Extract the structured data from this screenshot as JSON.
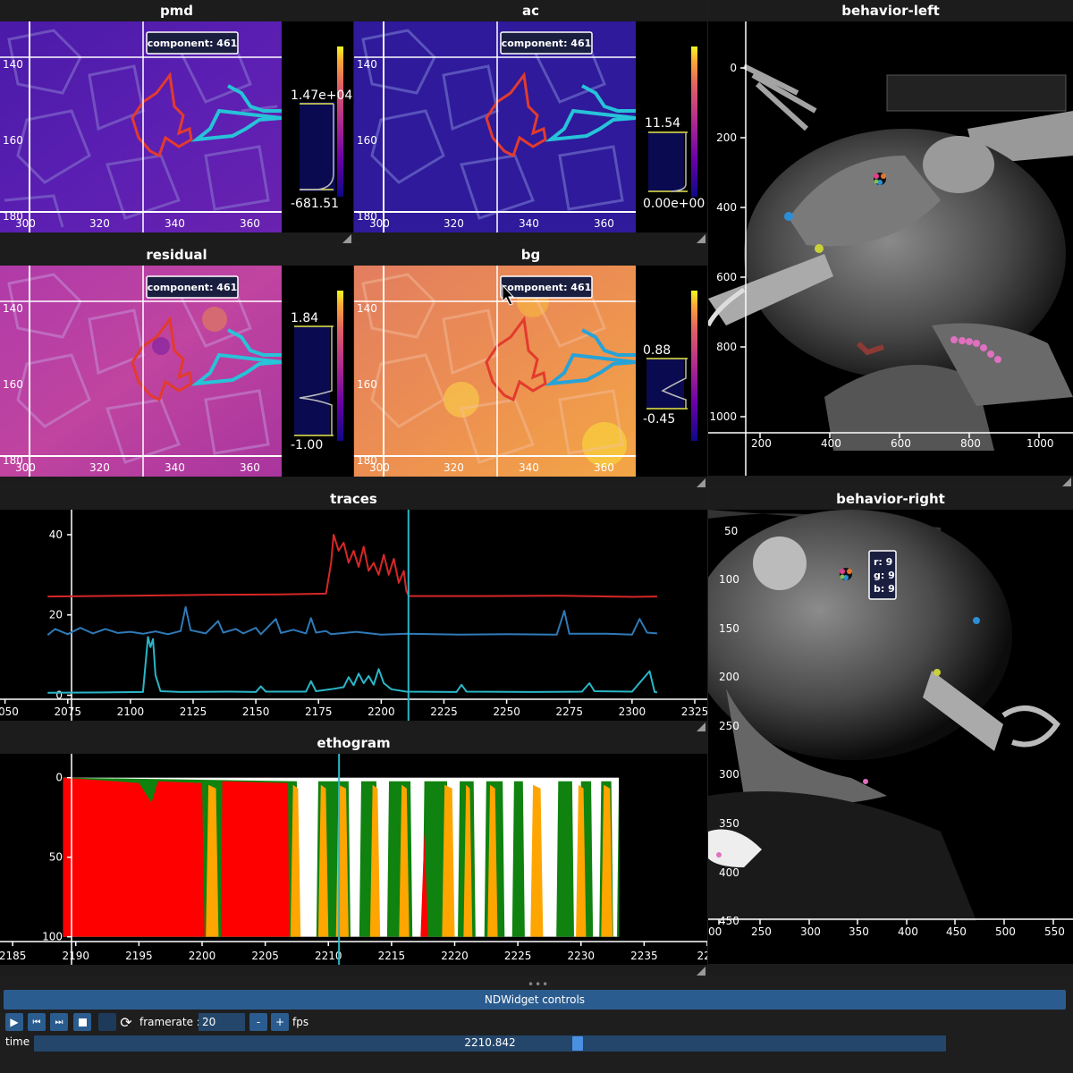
{
  "panels": {
    "pmd": {
      "title": "pmd",
      "tooltip": "component: 461",
      "cmax": "1.47e+04",
      "cmin": "-681.51"
    },
    "ac": {
      "title": "ac",
      "tooltip": "component: 461",
      "cmax": "11.54",
      "cmin": "0.00e+00"
    },
    "residual": {
      "title": "residual",
      "tooltip": "component: 461",
      "cmax": "1.84",
      "cmin": "-1.00"
    },
    "bg": {
      "title": "bg",
      "tooltip": "component: 461",
      "cmax": "0.88",
      "cmin": "-0.45"
    },
    "behavior_left": {
      "title": "behavior-left"
    },
    "behavior_right": {
      "title": "behavior-right",
      "pixel_info": {
        "r": "r: 9",
        "g": "g: 9",
        "b": "b: 9"
      }
    },
    "traces": {
      "title": "traces"
    },
    "ethogram": {
      "title": "ethogram"
    }
  },
  "image_axes": {
    "x_ticks": [
      "300",
      "320",
      "340",
      "360"
    ],
    "y_ticks": [
      "140",
      "160",
      "180"
    ]
  },
  "behavior_left_axes": {
    "x_ticks": [
      "200",
      "400",
      "600",
      "800",
      "1000"
    ],
    "y_ticks": [
      "0",
      "200",
      "400",
      "600",
      "800",
      "1000"
    ]
  },
  "behavior_right_axes": {
    "x_ticks": [
      "00",
      "250",
      "300",
      "350",
      "400",
      "450",
      "500",
      "550"
    ],
    "y_ticks": [
      "50",
      "100",
      "150",
      "200",
      "250",
      "300",
      "350",
      "400",
      "450"
    ]
  },
  "chart_data": [
    {
      "type": "line",
      "title": "traces",
      "xlim": [
        2048,
        2330
      ],
      "ylim": [
        -1,
        44
      ],
      "x_ticks": [
        "2050",
        "2075",
        "2100",
        "2125",
        "2150",
        "2175",
        "2200",
        "2225",
        "2250",
        "2275",
        "2300",
        "2325",
        "23"
      ],
      "y_ticks": [
        "40",
        "20",
        "0"
      ],
      "cursor_x": 2210.842,
      "colors": [
        "#d62728",
        "#2f7ab8",
        "#2ab6c7"
      ],
      "series": [
        {
          "values": [
            [
              2067,
              24.6
            ],
            [
              2100,
              24.8
            ],
            [
              2130,
              25.0
            ],
            [
              2160,
              25.1
            ],
            [
              2178,
              25.3
            ],
            [
              2180,
              33
            ],
            [
              2181,
              40
            ],
            [
              2183,
              36
            ],
            [
              2185,
              38
            ],
            [
              2187,
              33
            ],
            [
              2189,
              36
            ],
            [
              2191,
              32
            ],
            [
              2193,
              37
            ],
            [
              2195,
              31
            ],
            [
              2197,
              33
            ],
            [
              2199,
              30
            ],
            [
              2201,
              35
            ],
            [
              2203,
              30
            ],
            [
              2205,
              34
            ],
            [
              2207,
              28
            ],
            [
              2209,
              31
            ],
            [
              2210,
              26
            ],
            [
              2211,
              24.7
            ],
            [
              2240,
              24.7
            ],
            [
              2270,
              24.8
            ],
            [
              2300,
              24.5
            ],
            [
              2310,
              24.6
            ]
          ]
        },
        {
          "values": [
            [
              2067,
              15
            ],
            [
              2070,
              16.5
            ],
            [
              2075,
              15.2
            ],
            [
              2080,
              16.8
            ],
            [
              2085,
              15.4
            ],
            [
              2090,
              16.5
            ],
            [
              2095,
              15.5
            ],
            [
              2100,
              15.8
            ],
            [
              2105,
              15.3
            ],
            [
              2110,
              15.9
            ],
            [
              2115,
              15.2
            ],
            [
              2120,
              16
            ],
            [
              2122,
              22
            ],
            [
              2124,
              16.2
            ],
            [
              2130,
              15.4
            ],
            [
              2135,
              18.5
            ],
            [
              2137,
              15.6
            ],
            [
              2142,
              16.5
            ],
            [
              2145,
              15.4
            ],
            [
              2150,
              16.8
            ],
            [
              2152,
              15.2
            ],
            [
              2158,
              19
            ],
            [
              2160,
              15.5
            ],
            [
              2165,
              16.3
            ],
            [
              2170,
              15.4
            ],
            [
              2172,
              19.2
            ],
            [
              2174,
              15.6
            ],
            [
              2178,
              16
            ],
            [
              2180,
              15.2
            ],
            [
              2190,
              15.8
            ],
            [
              2200,
              15.1
            ],
            [
              2210,
              15.3
            ],
            [
              2230,
              15.1
            ],
            [
              2250,
              15.2
            ],
            [
              2270,
              15.1
            ],
            [
              2273,
              21
            ],
            [
              2275,
              15.3
            ],
            [
              2290,
              15.3
            ],
            [
              2300,
              15.1
            ],
            [
              2303,
              19
            ],
            [
              2306,
              15.6
            ],
            [
              2310,
              15.4
            ]
          ]
        },
        {
          "values": [
            [
              2067,
              0.6
            ],
            [
              2090,
              0.7
            ],
            [
              2105,
              0.8
            ],
            [
              2107,
              14.5
            ],
            [
              2108,
              12
            ],
            [
              2109,
              14
            ],
            [
              2110,
              5
            ],
            [
              2112,
              1
            ],
            [
              2120,
              0.8
            ],
            [
              2140,
              0.9
            ],
            [
              2150,
              0.8
            ],
            [
              2152,
              2.2
            ],
            [
              2154,
              0.9
            ],
            [
              2170,
              0.9
            ],
            [
              2172,
              3.5
            ],
            [
              2174,
              1
            ],
            [
              2180,
              1.5
            ],
            [
              2185,
              2
            ],
            [
              2187,
              4.5
            ],
            [
              2189,
              2.5
            ],
            [
              2191,
              5.4
            ],
            [
              2193,
              3
            ],
            [
              2195,
              4.8
            ],
            [
              2197,
              2.6
            ],
            [
              2199,
              6.5
            ],
            [
              2201,
              3
            ],
            [
              2204,
              1.5
            ],
            [
              2210,
              0.9
            ],
            [
              2230,
              0.8
            ],
            [
              2232,
              2.6
            ],
            [
              2234,
              0.9
            ],
            [
              2260,
              0.8
            ],
            [
              2280,
              0.9
            ],
            [
              2283,
              3
            ],
            [
              2285,
              1
            ],
            [
              2300,
              0.9
            ],
            [
              2307,
              6
            ],
            [
              2309,
              0.8
            ],
            [
              2310,
              0.7
            ]
          ]
        }
      ]
    },
    {
      "type": "area",
      "title": "ethogram",
      "xlim": [
        2184,
        2240
      ],
      "ylim": [
        -15,
        103
      ],
      "y_inverted": true,
      "x_ticks": [
        "2185",
        "2190",
        "2195",
        "2200",
        "2205",
        "2210",
        "2215",
        "2220",
        "2225",
        "2230",
        "2235",
        "224"
      ],
      "y_ticks": [
        "0",
        "50",
        "100"
      ],
      "cursor_x": 2210.842,
      "colors": [
        "#ff0000",
        "#ffa500",
        "#0f820f",
        "#ffffff"
      ],
      "x_range": [
        2189,
        2233
      ]
    }
  ],
  "controls": {
    "header": "NDWidget controls",
    "framerate_label": "framerate :",
    "framerate_value": "20",
    "minus": "-",
    "plus": "+",
    "fps": "fps",
    "time_label": "time",
    "time_value": "2210.842",
    "time_fraction": 0.59
  }
}
